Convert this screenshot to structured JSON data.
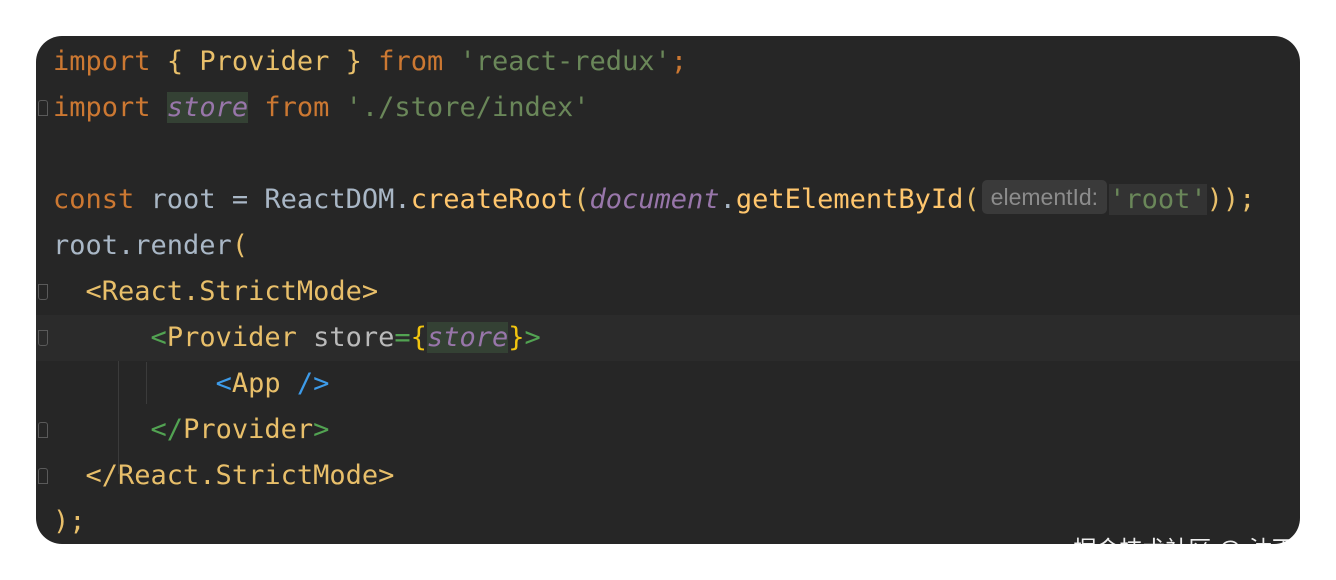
{
  "code": {
    "line1": {
      "import": "import",
      "open_brace": "{",
      "provider": "Provider",
      "close_brace": "}",
      "from": "from",
      "module": "'react-redux'",
      "semicolon": ";"
    },
    "line2": {
      "import": "import",
      "store": "store",
      "from": "from",
      "module": "'./store/index'"
    },
    "line4": {
      "const": "const",
      "root": "root",
      "eq": "=",
      "reactdom": "ReactDOM",
      "dot1": ".",
      "createRoot": "createRoot",
      "paren1": "(",
      "document": "document",
      "dot2": ".",
      "getElementById": "getElementById",
      "paren2": "(",
      "hint": "elementId:",
      "arg": "'root'",
      "close": "));"
    },
    "line5": {
      "root_render": "root.render",
      "paren": "("
    },
    "line6": {
      "tag_open": "<React.StrictMode>"
    },
    "line7": {
      "lt": "<",
      "provider": "Provider",
      "attr": "store",
      "eq": "=",
      "brace_open": "{",
      "store": "store",
      "brace_close": "}",
      "gt": ">"
    },
    "line8": {
      "lt": "<",
      "app": "App",
      "self_close": "/>"
    },
    "line9": {
      "lt": "</",
      "provider": "Provider",
      "gt": ">"
    },
    "line10": {
      "tag_close": "</React.StrictMode>"
    },
    "line11": {
      "close": ");"
    }
  },
  "watermark": "掘金技术社区 @ 沐雨林",
  "colors": {
    "background": "#262626",
    "keyword": "#cc7832",
    "string": "#6a8759",
    "function": "#ffc66d",
    "variable_italic": "#9876aa",
    "jsx_bracket": "#52a352",
    "self_close": "#3d9be9"
  }
}
